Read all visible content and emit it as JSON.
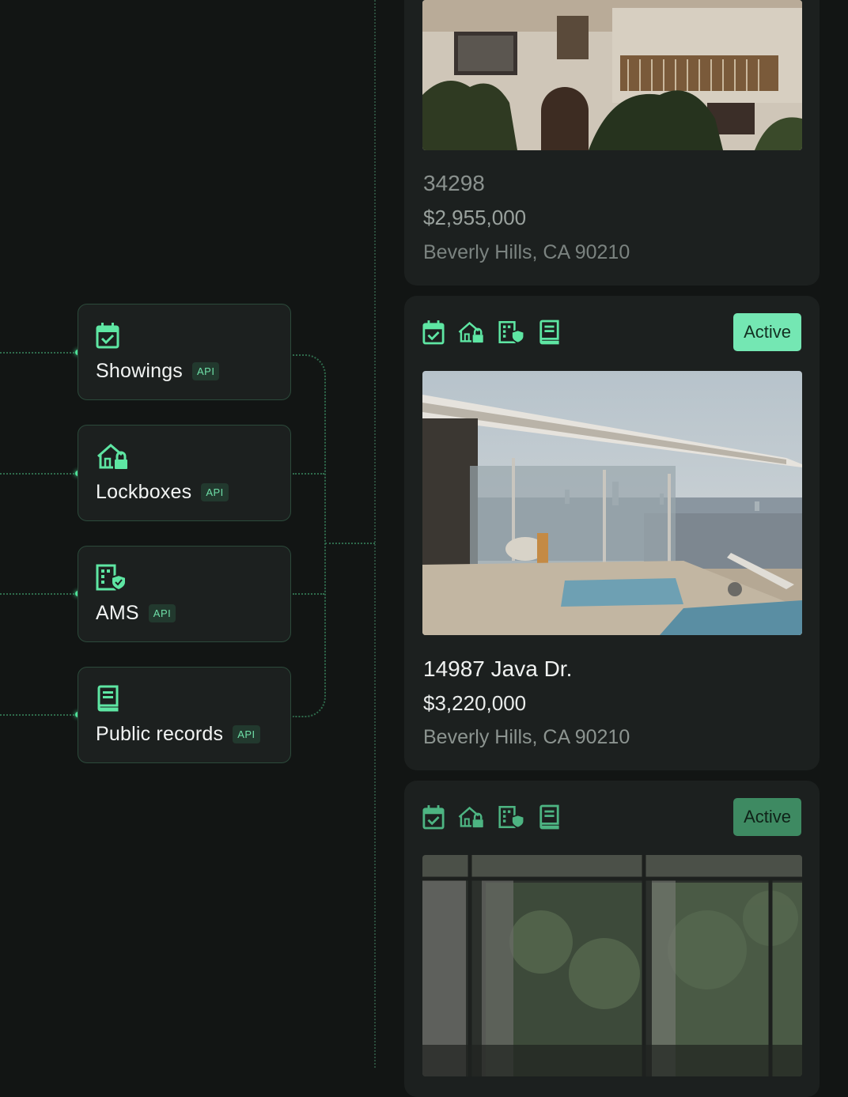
{
  "integrations": [
    {
      "icon": "calendar-check-icon",
      "label": "Showings",
      "badge": "API"
    },
    {
      "icon": "house-lock-icon",
      "label": "Lockboxes",
      "badge": "API"
    },
    {
      "icon": "building-shield-icon",
      "label": "AMS",
      "badge": "API"
    },
    {
      "icon": "records-book-icon",
      "label": "Public records",
      "badge": "API"
    }
  ],
  "listings": [
    {
      "title": "34298",
      "price": "$2,955,000",
      "location": "Beverly Hills, CA 90210",
      "photo": "spanish-villa-photo"
    },
    {
      "title": "14987 Java Dr.",
      "price": "$3,220,000",
      "location": "Beverly Hills, CA 90210",
      "status": "Active",
      "photo": "hillside-modern-home-photo"
    },
    {
      "status": "Active",
      "photo": "glass-house-interior-photo"
    }
  ],
  "colors": {
    "background": "#121514",
    "card": "#1c201f",
    "accent": "#4ee39a",
    "status_active": "#74e7b3"
  }
}
